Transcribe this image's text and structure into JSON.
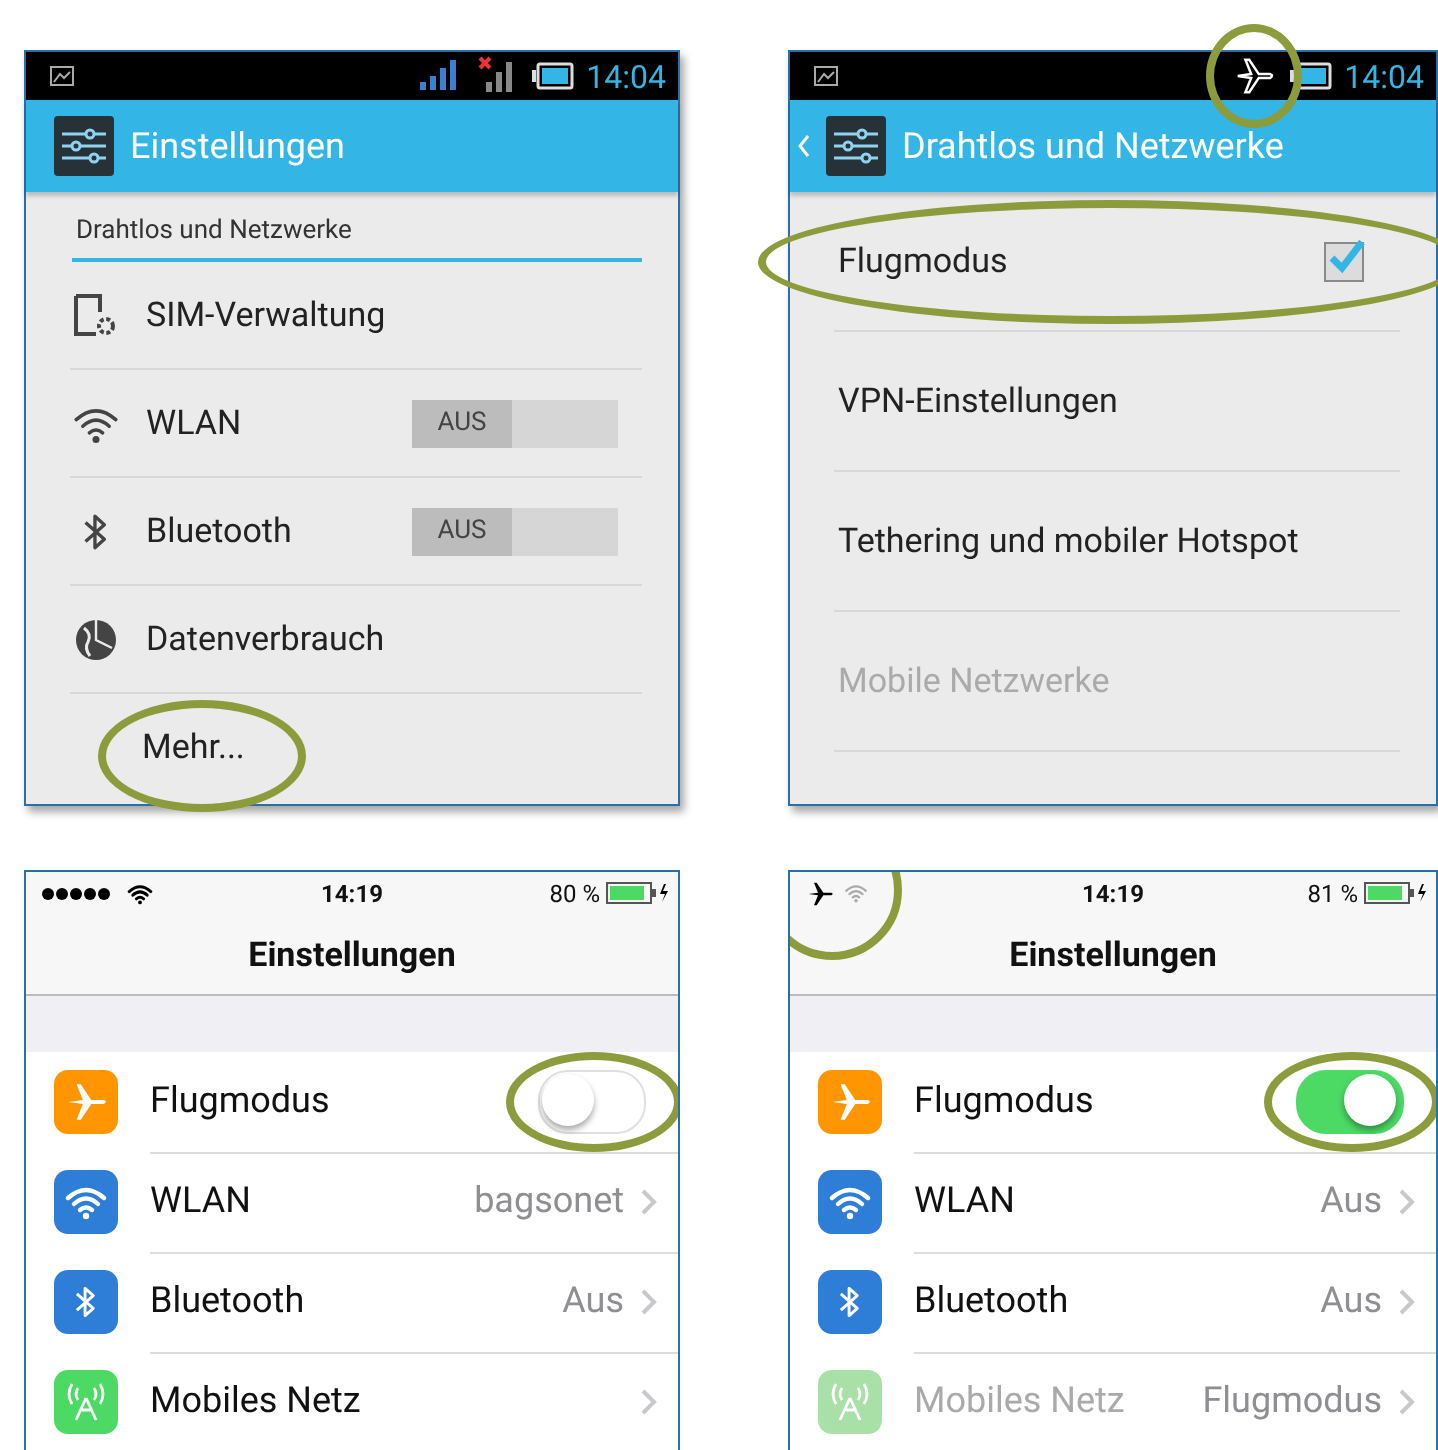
{
  "android_screens": [
    {
      "status_bar": {
        "time": "14:04",
        "airplane_mode": false
      },
      "action_bar": {
        "title": "Einstellungen"
      },
      "section_header": "Drahtlos und Netzwerke",
      "items": [
        {
          "kind": "sim",
          "label": "SIM-Verwaltung"
        },
        {
          "kind": "wifi",
          "label": "WLAN",
          "switch": {
            "label": "AUS",
            "on": false
          }
        },
        {
          "kind": "bluetooth",
          "label": "Bluetooth",
          "switch": {
            "label": "AUS",
            "on": false
          }
        },
        {
          "kind": "data",
          "label": "Datenverbrauch"
        },
        {
          "kind": "indent",
          "label": "Mehr...",
          "highlighted": true
        }
      ]
    },
    {
      "status_bar": {
        "time": "14:04",
        "airplane_mode": true,
        "highlighted": true
      },
      "action_bar": {
        "title": "Drahtlos und Netzwerke",
        "back": true
      },
      "items": [
        {
          "kind": "checkbox",
          "label": "Flugmodus",
          "checked": true,
          "highlighted": true
        },
        {
          "kind": "plain",
          "label": "VPN-Einstellungen"
        },
        {
          "kind": "plain",
          "label": "Tethering und mobiler Hotspot"
        },
        {
          "kind": "plain",
          "label": "Mobile Netzwerke",
          "disabled": true
        }
      ]
    }
  ],
  "ios_screens": [
    {
      "status_bar": {
        "time": "14:19",
        "battery": "80 %",
        "airplane_mode": false
      },
      "title": "Einstellungen",
      "items": [
        {
          "kind": "airplane",
          "label": "Flugmodus",
          "toggle_on": false,
          "highlighted": true
        },
        {
          "kind": "wifi",
          "label": "WLAN",
          "value": "bagsonet"
        },
        {
          "kind": "bluetooth",
          "label": "Bluetooth",
          "value": "Aus"
        },
        {
          "kind": "cellular",
          "label": "Mobiles Netz",
          "disabled": false
        }
      ]
    },
    {
      "status_bar": {
        "time": "14:19",
        "battery": "81 %",
        "airplane_mode": true,
        "highlighted": true
      },
      "title": "Einstellungen",
      "items": [
        {
          "kind": "airplane",
          "label": "Flugmodus",
          "toggle_on": true,
          "highlighted": true
        },
        {
          "kind": "wifi",
          "label": "WLAN",
          "value": "Aus"
        },
        {
          "kind": "bluetooth",
          "label": "Bluetooth",
          "value": "Aus"
        },
        {
          "kind": "cellular",
          "label": "Mobiles Netz",
          "value": "Flugmodus",
          "disabled": true
        }
      ]
    }
  ]
}
